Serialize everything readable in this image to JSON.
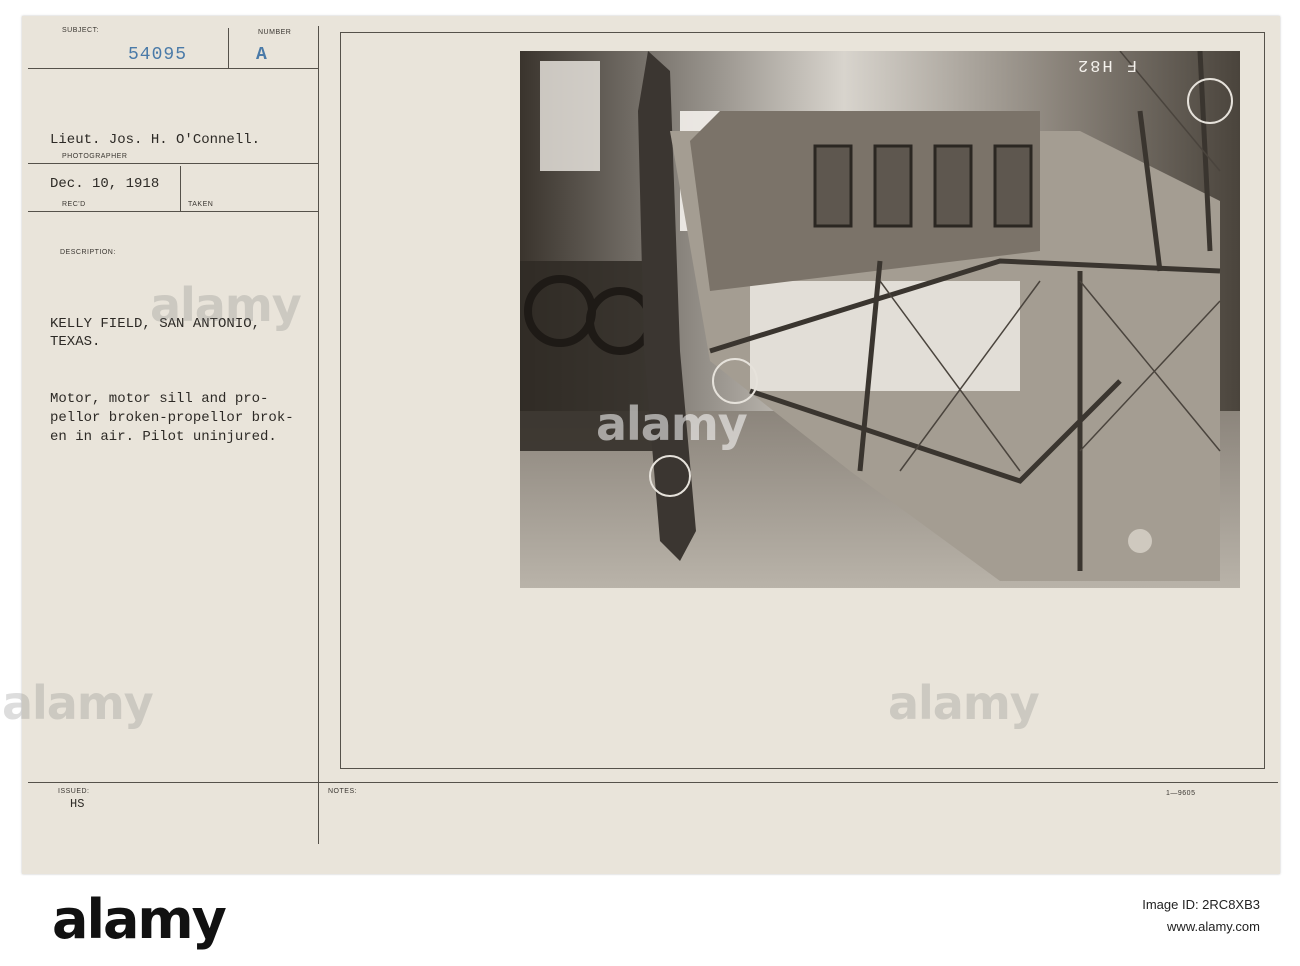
{
  "record": {
    "subject_label": "SUBJECT:",
    "subject_value": "54095",
    "number_label": "NUMBER",
    "number_value": "A",
    "photographer": "Lieut. Jos. H. O'Connell.",
    "photographer_label": "PHOTOGRAPHER",
    "recd_date": "Dec. 10, 1918",
    "recd_label": "REC'D",
    "taken_label": "TAKEN",
    "description_label": "DESCRIPTION:",
    "location_line1": "KELLY FIELD, SAN ANTONIO,",
    "location_line2": "TEXAS.",
    "desc_line1": "Motor, motor sill and pro-",
    "desc_line2": "pellor broken-propellor brok-",
    "desc_line3": "en in air. Pilot uninjured.",
    "issued_label": "ISSUED:",
    "issued_value": "HS",
    "notes_label": "NOTES:",
    "form_number": "1—9605"
  },
  "photo": {
    "negative_mark": "F H82"
  },
  "watermarks": {
    "text": "alamy"
  },
  "footer": {
    "logo": "alamy",
    "image_id_line": "Image ID: 2RC8XB3",
    "site": "www.alamy.com"
  }
}
